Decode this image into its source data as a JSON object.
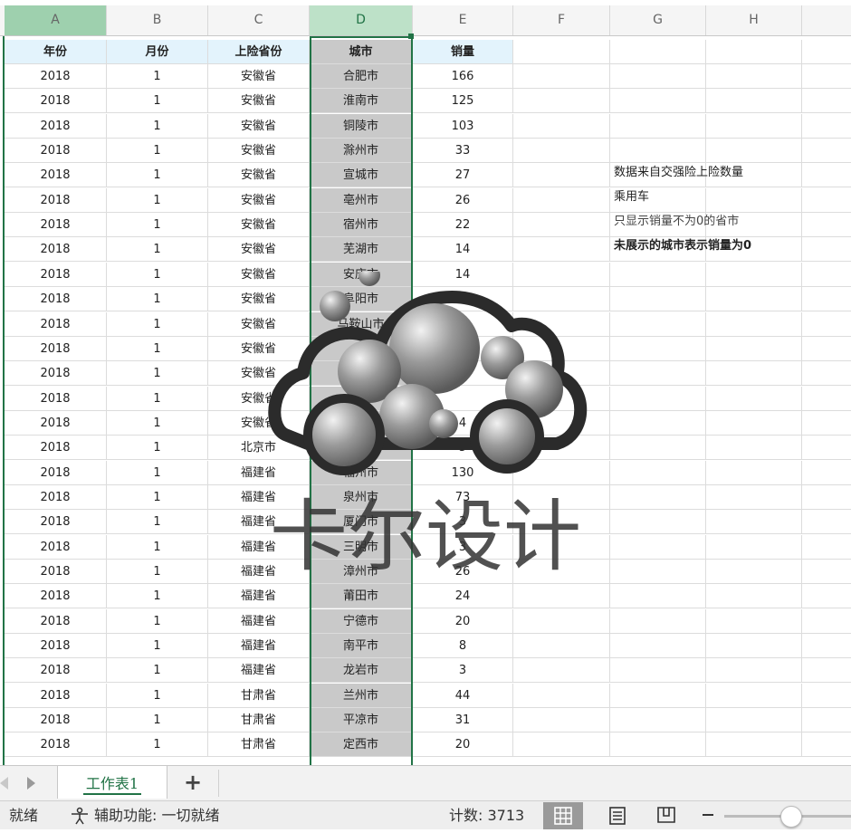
{
  "columns": [
    "A",
    "B",
    "C",
    "D",
    "E",
    "F",
    "G",
    "H"
  ],
  "header": [
    "年份",
    "月份",
    "上险省份",
    "城市",
    "销量"
  ],
  "rows": [
    [
      "2018",
      "1",
      "安徽省",
      "合肥市",
      "166"
    ],
    [
      "2018",
      "1",
      "安徽省",
      "淮南市",
      "125"
    ],
    [
      "2018",
      "1",
      "安徽省",
      "铜陵市",
      "103"
    ],
    [
      "2018",
      "1",
      "安徽省",
      "滁州市",
      "33"
    ],
    [
      "2018",
      "1",
      "安徽省",
      "宣城市",
      "27"
    ],
    [
      "2018",
      "1",
      "安徽省",
      "亳州市",
      "26"
    ],
    [
      "2018",
      "1",
      "安徽省",
      "宿州市",
      "22"
    ],
    [
      "2018",
      "1",
      "安徽省",
      "芜湖市",
      "14"
    ],
    [
      "2018",
      "1",
      "安徽省",
      "安庆市",
      "14"
    ],
    [
      "2018",
      "1",
      "安徽省",
      "阜阳市",
      "13"
    ],
    [
      "2018",
      "1",
      "安徽省",
      "马鞍山市",
      ""
    ],
    [
      "2018",
      "1",
      "安徽省",
      "",
      ""
    ],
    [
      "2018",
      "1",
      "安徽省",
      "",
      ""
    ],
    [
      "2018",
      "1",
      "安徽省",
      "",
      ""
    ],
    [
      "2018",
      "1",
      "安徽省",
      "",
      "4"
    ],
    [
      "2018",
      "1",
      "北京市",
      "",
      "5"
    ],
    [
      "2018",
      "1",
      "福建省",
      "福州市",
      "130"
    ],
    [
      "2018",
      "1",
      "福建省",
      "泉州市",
      "73"
    ],
    [
      "2018",
      "1",
      "福建省",
      "厦门市",
      "3"
    ],
    [
      "2018",
      "1",
      "福建省",
      "三明市",
      "3"
    ],
    [
      "2018",
      "1",
      "福建省",
      "漳州市",
      "26"
    ],
    [
      "2018",
      "1",
      "福建省",
      "莆田市",
      "24"
    ],
    [
      "2018",
      "1",
      "福建省",
      "宁德市",
      "20"
    ],
    [
      "2018",
      "1",
      "福建省",
      "南平市",
      "8"
    ],
    [
      "2018",
      "1",
      "福建省",
      "龙岩市",
      "3"
    ],
    [
      "2018",
      "1",
      "甘肃省",
      "兰州市",
      "44"
    ],
    [
      "2018",
      "1",
      "甘肃省",
      "平凉市",
      "31"
    ],
    [
      "2018",
      "1",
      "甘肃省",
      "定西市",
      "20"
    ]
  ],
  "notes": [
    "数据来自交强险上险数量",
    "乘用车",
    "只显示销量不为0的省市",
    "未展示的城市表示销量为0"
  ],
  "watermark": "卡尔设计",
  "sheet_tab": "工作表1",
  "add_sheet": "+",
  "status": {
    "ready": "就绪",
    "accessibility": "辅助功能: 一切就绪",
    "count": "计数: 3713"
  },
  "colors": {
    "accent": "#217346",
    "selected_col": "#c9c9c9",
    "header_fill": "#e3f3fc"
  }
}
